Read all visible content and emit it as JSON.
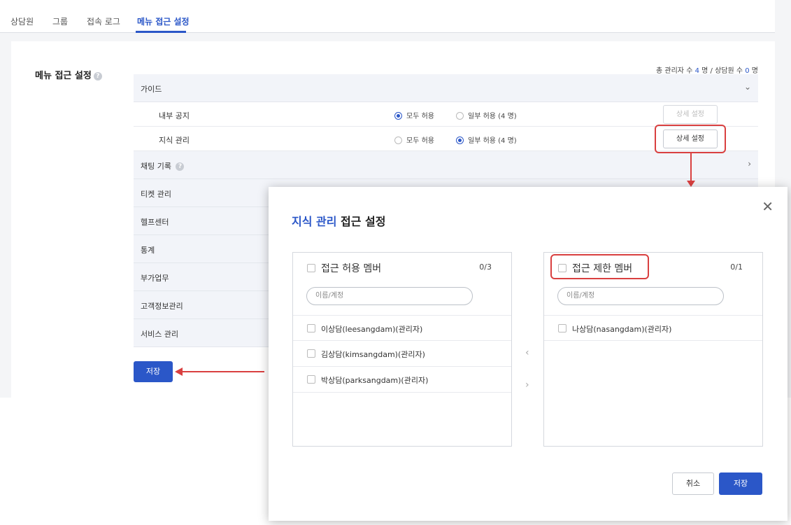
{
  "tabs": [
    {
      "label": "상담원"
    },
    {
      "label": "그룹"
    },
    {
      "label": "접속 로그"
    },
    {
      "label": "메뉴 접근 설정"
    }
  ],
  "section": {
    "title": "메뉴 접근 설정",
    "help_icon": "?",
    "summary_prefix": "총 관리자 수",
    "admin_count": "4",
    "summary_mid": "명 / 상담원 수",
    "agent_count": "0",
    "summary_suffix": "명"
  },
  "menu": {
    "groups": [
      {
        "label": "가이드",
        "chevron": "⌄"
      },
      {
        "label": "채팅 기록",
        "chevron": "›"
      },
      {
        "label": "티켓 관리"
      },
      {
        "label": "헬프센터"
      },
      {
        "label": "통계"
      },
      {
        "label": "부가업무"
      },
      {
        "label": "고객정보관리"
      },
      {
        "label": "서비스 관리"
      }
    ],
    "sub_items": [
      {
        "label": "내부 공지",
        "all": "모두 허용",
        "partial": "일부 허용 (4 명)",
        "detail": "상세 설정",
        "selected": "all"
      },
      {
        "label": "지식 관리",
        "all": "모두 허용",
        "partial": "일부 허용 (4 명)",
        "detail": "상세 설정",
        "selected": "partial"
      }
    ]
  },
  "save_label": "저장",
  "modal": {
    "title_accent": "지식 관리",
    "title_rest": "접근 설정",
    "close_icon": "✕",
    "allowed": {
      "heading": "접근 허용 멤버",
      "count": "0/3",
      "placeholder": "이름/계정",
      "members": [
        "이상담(leesangdam)(관리자)",
        "김상담(kimsangdam)(관리자)",
        "박상담(parksangdam)(관리자)"
      ]
    },
    "restricted": {
      "heading": "접근 제한 멤버",
      "count": "0/1",
      "placeholder": "이름/계정",
      "members": [
        "나상담(nasangdam)(관리자)"
      ]
    },
    "move_left_icon": "‹",
    "move_right_icon": "›",
    "cancel_label": "취소",
    "save_label": "저장"
  },
  "colors": {
    "accent": "#2b57c8",
    "highlight": "#d94040"
  }
}
